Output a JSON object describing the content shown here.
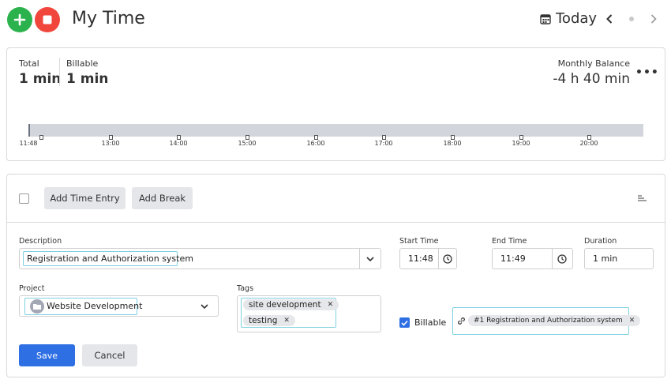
{
  "header": {
    "title": "My Time",
    "today_label": "Today",
    "icons": {
      "add": "plus-icon",
      "stop": "stop-icon",
      "calendar": "calendar-icon",
      "prev": "chevron-left-icon",
      "next": "chevron-right-icon"
    },
    "colors": {
      "add": "#2bb24c",
      "stop": "#f0463c"
    }
  },
  "summary": {
    "total_label": "Total",
    "total_value": "1 min",
    "billable_label": "Billable",
    "billable_value": "1 min",
    "balance_label": "Monthly Balance",
    "balance_value": "-4 h 40 min",
    "more_label": "•••",
    "timeline_ticks": [
      "11:48",
      "13:00",
      "14:00",
      "15:00",
      "16:00",
      "17:00",
      "18:00",
      "19:00",
      "20:00"
    ]
  },
  "toolbar": {
    "add_time_entry": "Add Time Entry",
    "add_break": "Add Break"
  },
  "form": {
    "description_label": "Description",
    "description_value": "Registration and Authorization system",
    "start_label": "Start Time",
    "start_value": "11:48",
    "end_label": "End Time",
    "end_value": "11:49",
    "duration_label": "Duration",
    "duration_value": "1 min",
    "project_label": "Project",
    "project_value": "Website Development",
    "tags_label": "Tags",
    "tags": [
      "site development",
      "testing"
    ],
    "billable_label": "Billable",
    "billable_checked": true,
    "linked_issue": "#1 Registration and Authorization system",
    "save_label": "Save",
    "cancel_label": "Cancel",
    "colors": {
      "primary": "#2f6fe4",
      "highlight": "#7fd0e0"
    }
  }
}
